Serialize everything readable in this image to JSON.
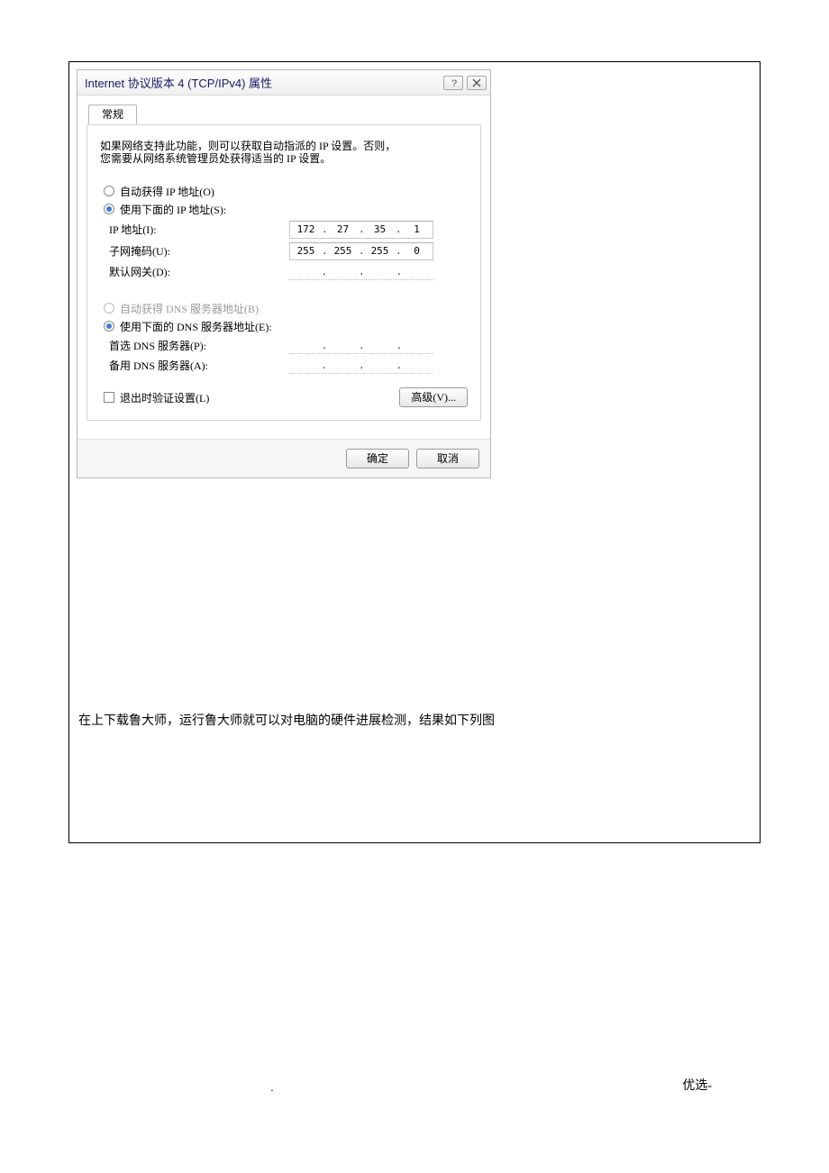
{
  "dialog": {
    "title": "Internet 协议版本 4 (TCP/IPv4) 属性",
    "help_icon": "?",
    "close_icon": "✕",
    "tab_label": "常规",
    "hint_line1": "如果网络支持此功能，则可以获取自动指派的 IP 设置。否则，",
    "hint_line2": "您需要从网络系统管理员处获得适当的 IP 设置。",
    "radio_auto_ip": "自动获得 IP 地址(O)",
    "radio_use_ip": "使用下面的 IP 地址(S):",
    "label_ip": "IP 地址(I):",
    "label_mask": "子网掩码(U):",
    "label_gw": "默认网关(D):",
    "ip": {
      "a": "172",
      "b": "27",
      "c": "35",
      "d": "1"
    },
    "mask": {
      "a": "255",
      "b": "255",
      "c": "255",
      "d": "0"
    },
    "gw": {
      "a": "",
      "b": "",
      "c": "",
      "d": ""
    },
    "radio_auto_dns": "自动获得 DNS 服务器地址(B)",
    "radio_use_dns": "使用下面的 DNS 服务器地址(E):",
    "label_dns1": "首选 DNS 服务器(P):",
    "label_dns2": "备用 DNS 服务器(A):",
    "dns1": {
      "a": "",
      "b": "",
      "c": "",
      "d": ""
    },
    "dns2": {
      "a": "",
      "b": "",
      "c": "",
      "d": ""
    },
    "checkbox_label": "退出时验证设置(L)",
    "btn_advanced": "高级(V)...",
    "btn_ok": "确定",
    "btn_cancel": "取消"
  },
  "caption": "在上下载鲁大师，运行鲁大师就可以对电脑的硬件进展检测，结果如下列图",
  "footer_dot": ".",
  "footer_text": "优选-"
}
